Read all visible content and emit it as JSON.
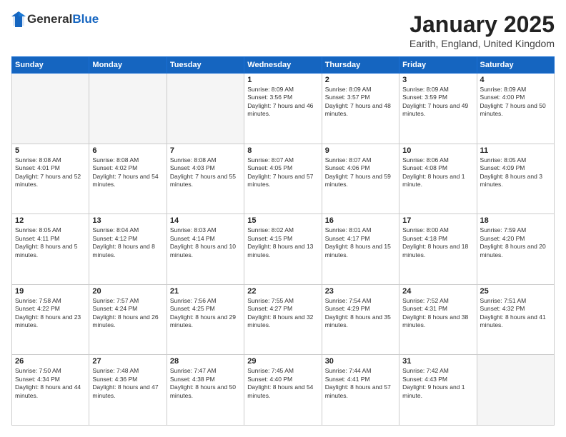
{
  "logo": {
    "general": "General",
    "blue": "Blue"
  },
  "title": "January 2025",
  "location": "Earith, England, United Kingdom",
  "days_of_week": [
    "Sunday",
    "Monday",
    "Tuesday",
    "Wednesday",
    "Thursday",
    "Friday",
    "Saturday"
  ],
  "weeks": [
    [
      {
        "day": "",
        "info": ""
      },
      {
        "day": "",
        "info": ""
      },
      {
        "day": "",
        "info": ""
      },
      {
        "day": "1",
        "info": "Sunrise: 8:09 AM\nSunset: 3:56 PM\nDaylight: 7 hours and 46 minutes."
      },
      {
        "day": "2",
        "info": "Sunrise: 8:09 AM\nSunset: 3:57 PM\nDaylight: 7 hours and 48 minutes."
      },
      {
        "day": "3",
        "info": "Sunrise: 8:09 AM\nSunset: 3:59 PM\nDaylight: 7 hours and 49 minutes."
      },
      {
        "day": "4",
        "info": "Sunrise: 8:09 AM\nSunset: 4:00 PM\nDaylight: 7 hours and 50 minutes."
      }
    ],
    [
      {
        "day": "5",
        "info": "Sunrise: 8:08 AM\nSunset: 4:01 PM\nDaylight: 7 hours and 52 minutes."
      },
      {
        "day": "6",
        "info": "Sunrise: 8:08 AM\nSunset: 4:02 PM\nDaylight: 7 hours and 54 minutes."
      },
      {
        "day": "7",
        "info": "Sunrise: 8:08 AM\nSunset: 4:03 PM\nDaylight: 7 hours and 55 minutes."
      },
      {
        "day": "8",
        "info": "Sunrise: 8:07 AM\nSunset: 4:05 PM\nDaylight: 7 hours and 57 minutes."
      },
      {
        "day": "9",
        "info": "Sunrise: 8:07 AM\nSunset: 4:06 PM\nDaylight: 7 hours and 59 minutes."
      },
      {
        "day": "10",
        "info": "Sunrise: 8:06 AM\nSunset: 4:08 PM\nDaylight: 8 hours and 1 minute."
      },
      {
        "day": "11",
        "info": "Sunrise: 8:05 AM\nSunset: 4:09 PM\nDaylight: 8 hours and 3 minutes."
      }
    ],
    [
      {
        "day": "12",
        "info": "Sunrise: 8:05 AM\nSunset: 4:11 PM\nDaylight: 8 hours and 5 minutes."
      },
      {
        "day": "13",
        "info": "Sunrise: 8:04 AM\nSunset: 4:12 PM\nDaylight: 8 hours and 8 minutes."
      },
      {
        "day": "14",
        "info": "Sunrise: 8:03 AM\nSunset: 4:14 PM\nDaylight: 8 hours and 10 minutes."
      },
      {
        "day": "15",
        "info": "Sunrise: 8:02 AM\nSunset: 4:15 PM\nDaylight: 8 hours and 13 minutes."
      },
      {
        "day": "16",
        "info": "Sunrise: 8:01 AM\nSunset: 4:17 PM\nDaylight: 8 hours and 15 minutes."
      },
      {
        "day": "17",
        "info": "Sunrise: 8:00 AM\nSunset: 4:18 PM\nDaylight: 8 hours and 18 minutes."
      },
      {
        "day": "18",
        "info": "Sunrise: 7:59 AM\nSunset: 4:20 PM\nDaylight: 8 hours and 20 minutes."
      }
    ],
    [
      {
        "day": "19",
        "info": "Sunrise: 7:58 AM\nSunset: 4:22 PM\nDaylight: 8 hours and 23 minutes."
      },
      {
        "day": "20",
        "info": "Sunrise: 7:57 AM\nSunset: 4:24 PM\nDaylight: 8 hours and 26 minutes."
      },
      {
        "day": "21",
        "info": "Sunrise: 7:56 AM\nSunset: 4:25 PM\nDaylight: 8 hours and 29 minutes."
      },
      {
        "day": "22",
        "info": "Sunrise: 7:55 AM\nSunset: 4:27 PM\nDaylight: 8 hours and 32 minutes."
      },
      {
        "day": "23",
        "info": "Sunrise: 7:54 AM\nSunset: 4:29 PM\nDaylight: 8 hours and 35 minutes."
      },
      {
        "day": "24",
        "info": "Sunrise: 7:52 AM\nSunset: 4:31 PM\nDaylight: 8 hours and 38 minutes."
      },
      {
        "day": "25",
        "info": "Sunrise: 7:51 AM\nSunset: 4:32 PM\nDaylight: 8 hours and 41 minutes."
      }
    ],
    [
      {
        "day": "26",
        "info": "Sunrise: 7:50 AM\nSunset: 4:34 PM\nDaylight: 8 hours and 44 minutes."
      },
      {
        "day": "27",
        "info": "Sunrise: 7:48 AM\nSunset: 4:36 PM\nDaylight: 8 hours and 47 minutes."
      },
      {
        "day": "28",
        "info": "Sunrise: 7:47 AM\nSunset: 4:38 PM\nDaylight: 8 hours and 50 minutes."
      },
      {
        "day": "29",
        "info": "Sunrise: 7:45 AM\nSunset: 4:40 PM\nDaylight: 8 hours and 54 minutes."
      },
      {
        "day": "30",
        "info": "Sunrise: 7:44 AM\nSunset: 4:41 PM\nDaylight: 8 hours and 57 minutes."
      },
      {
        "day": "31",
        "info": "Sunrise: 7:42 AM\nSunset: 4:43 PM\nDaylight: 9 hours and 1 minute."
      },
      {
        "day": "",
        "info": ""
      }
    ]
  ]
}
